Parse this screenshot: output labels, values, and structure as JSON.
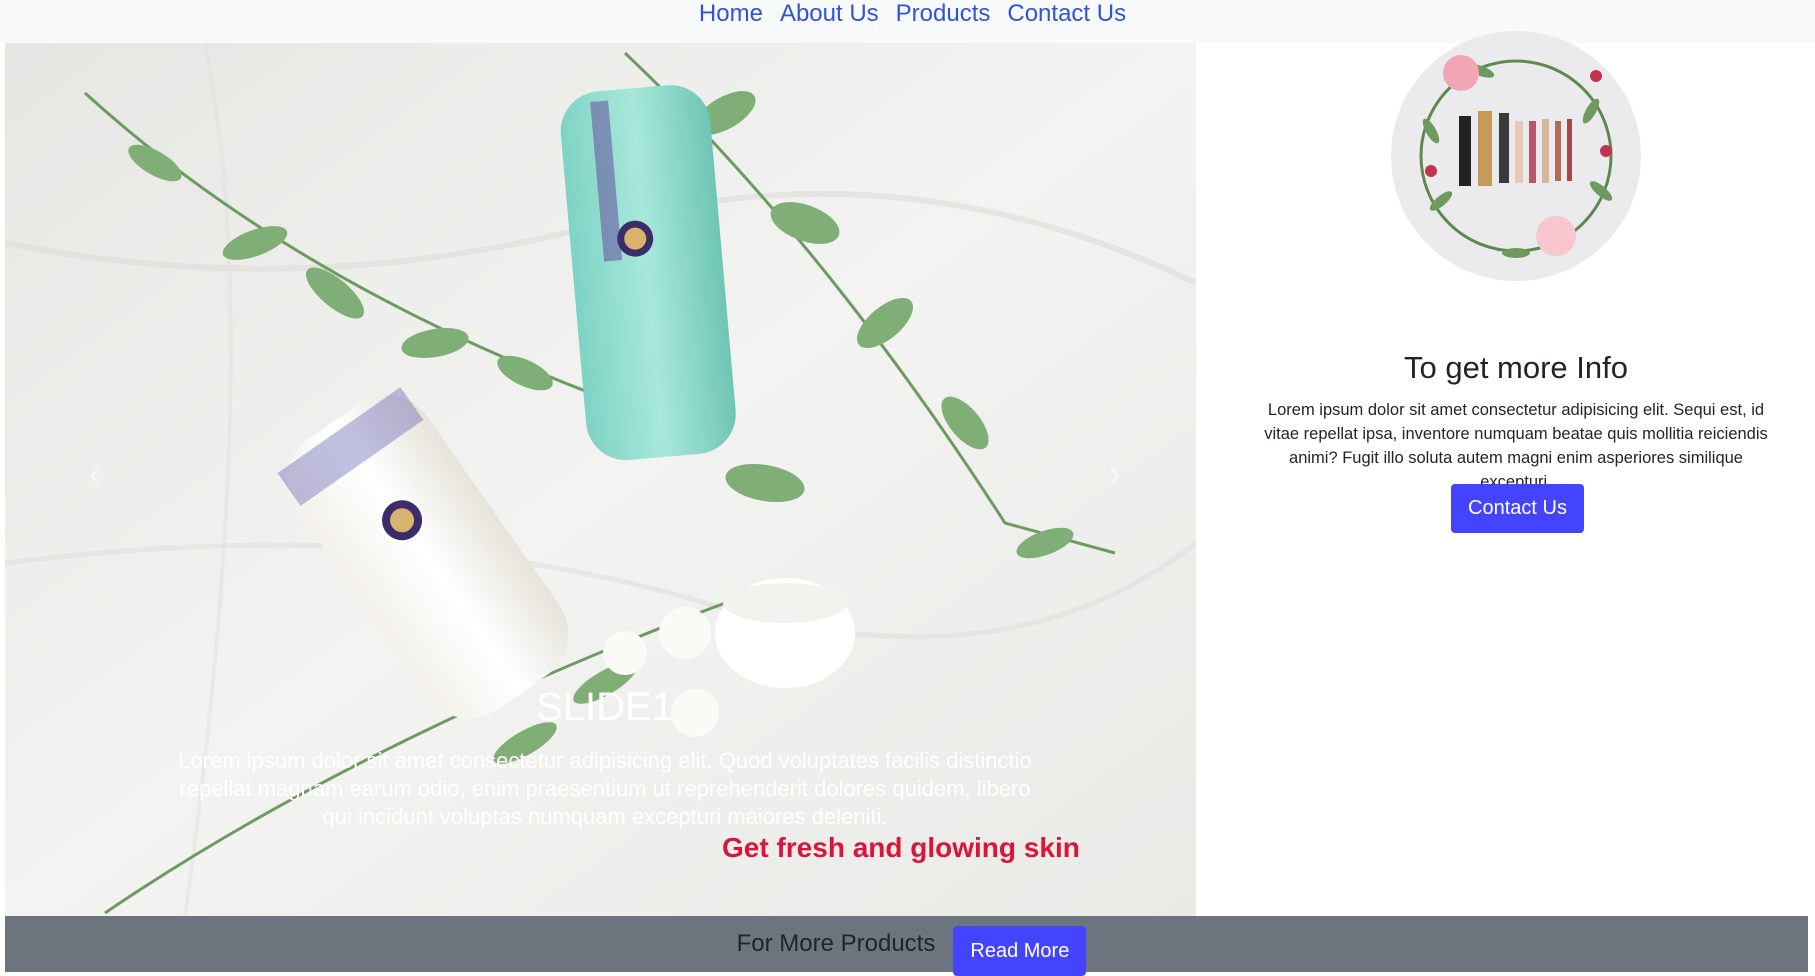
{
  "nav": {
    "items": [
      "Home",
      "About Us",
      "Products",
      "Contact Us"
    ]
  },
  "carousel": {
    "prev_glyph": "‹",
    "next_glyph": "›",
    "caption_title": "SLIDE1",
    "caption_text": "Lorem ipsum dolor sit amet consectetur adipisicing elit. Quod voluptates facilis distinctio repellat magnam earum odio, enim praesentium ut reprehenderit dolores quidem, libero qui incidunt voluptas numquam excepturi maiores deleniti.",
    "tagline": "Get fresh and glowing skin",
    "tagline_color": "#dc143c"
  },
  "info": {
    "title": "To get more Info",
    "text": "Lorem ipsum dolor sit amet consectetur adipisicing elit. Sequi est, id vitae repellat ipsa, inventore numquam beatae quis mollitia reiciendis animi? Fugit illo soluta autem magni enim asperiores similique excepturi.",
    "button_label": "Contact Us"
  },
  "footer": {
    "text": "For More Products",
    "button_label": "Read More"
  },
  "colors": {
    "accent_button": "#4444ff",
    "nav_link": "#2f55d4",
    "footer_bg": "#6c757d"
  }
}
